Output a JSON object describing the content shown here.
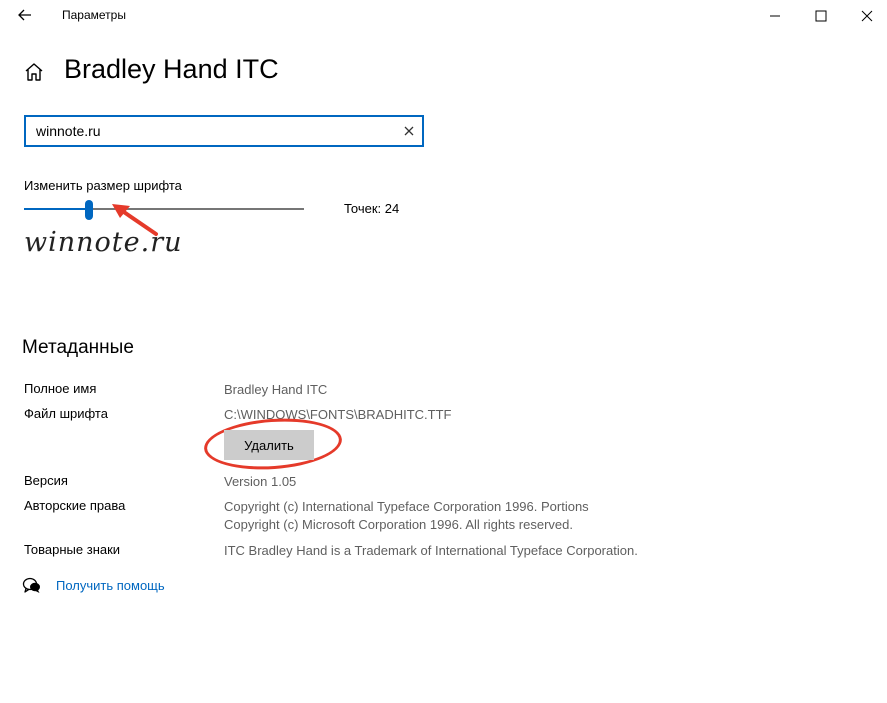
{
  "titlebar": {
    "title": "Параметры"
  },
  "page": {
    "title": "Bradley Hand ITC"
  },
  "preview": {
    "value": "winnote.ru"
  },
  "size": {
    "label": "Изменить размер шрифта",
    "points_text": "Точек: 24",
    "value": 24,
    "min": 1,
    "max": 100
  },
  "sample_text": "winnote.ru",
  "metadata": {
    "heading": "Метаданные",
    "full_name_label": "Полное имя",
    "full_name_value": "Bradley Hand ITC",
    "file_label": "Файл шрифта",
    "file_value": "C:\\WINDOWS\\FONTS\\BRADHITC.TTF",
    "delete_label": "Удалить",
    "version_label": "Версия",
    "version_value": "Version 1.05",
    "copyright_label": "Авторские права",
    "copyright_line1": "Copyright (c) International Typeface Corporation 1996.  Portions",
    "copyright_line2": "Copyright (c) Microsoft Corporation 1996.  All rights reserved.",
    "trademark_label": "Товарные знаки",
    "trademark_value": "ITC Bradley Hand is a Trademark of International Typeface Corporation."
  },
  "help": {
    "link": "Получить помощь"
  },
  "colors": {
    "accent": "#0067c0",
    "annotation": "#e53a2a",
    "button": "#cccccc"
  },
  "icons": [
    "back-arrow-icon",
    "minimize-icon",
    "maximize-icon",
    "close-icon",
    "home-icon",
    "clear-icon",
    "help-chat-icon"
  ]
}
